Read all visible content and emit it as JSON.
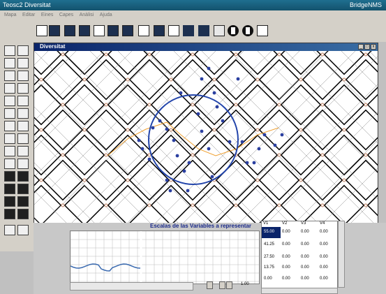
{
  "app": {
    "title": "Teosc2 Diversitat",
    "window_right": "BridgeNMS"
  },
  "menu": [
    "Mapa",
    "Editar",
    "Eines",
    "Capes",
    "Anàlisi",
    "Ajuda"
  ],
  "toolbar": [
    "doc-icon",
    "window-icon",
    "window-icon",
    "chart-icon",
    "map-icon",
    "table-icon",
    "tool-icon",
    "pattern-icon",
    "film-icon",
    "grid-icon",
    "butterfly-icon",
    "butterfly-icon",
    "printer-icon",
    "info-icon",
    "help-icon",
    "export-icon"
  ],
  "child_window": {
    "title": "Diversitat"
  },
  "chart": {
    "title": "Escalas de las Variables a representar",
    "zoom": "1.00"
  },
  "grid": {
    "headers": [
      "V1",
      "V2",
      "V3",
      "V4"
    ],
    "rows": [
      [
        "55.00",
        "0.00",
        "0.00",
        "0.00"
      ],
      [
        "41.25",
        "0.00",
        "0.00",
        "0.00"
      ],
      [
        "27.50",
        "0.00",
        "0.00",
        "0.00"
      ],
      [
        "13.75",
        "0.00",
        "0.00",
        "0.00"
      ],
      [
        "0.00",
        "0.00",
        "0.00",
        "0.00"
      ]
    ]
  },
  "colors": {
    "accent": "#1f6f8f",
    "circle": "#2244aa",
    "trend": "#f0a030",
    "points": "#2a3fa0"
  }
}
